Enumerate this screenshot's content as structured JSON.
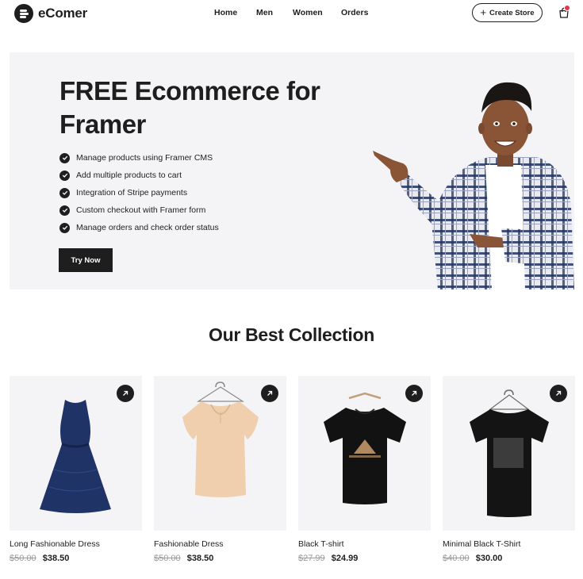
{
  "header": {
    "logo_text": "eComer",
    "nav": [
      "Home",
      "Men",
      "Women",
      "Orders"
    ],
    "create_store_label": "Create Store",
    "cart_badge_color": "#e8334a"
  },
  "hero": {
    "title": "FREE Ecommerce for Framer",
    "features": [
      "Manage products using Framer CMS",
      "Add multiple products to cart",
      "Integration of Stripe payments",
      "Custom checkout with Framer form",
      "Manage orders and check order status"
    ],
    "cta_label": "Try Now"
  },
  "collection": {
    "title": "Our Best Collection",
    "products": [
      {
        "name": "Long Fashionable Dress",
        "old_price": "$50.00",
        "price": "$38.50"
      },
      {
        "name": "Fashionable Dress",
        "old_price": "$50.00",
        "price": "$38.50"
      },
      {
        "name": "Black T-shirt",
        "old_price": "$27.99",
        "price": "$24.99"
      },
      {
        "name": "Minimal Black T-Shirt",
        "old_price": "$40.00",
        "price": "$30.00"
      }
    ]
  },
  "icons": {
    "logo": "logo-mark-icon",
    "plus": "plus-icon",
    "cart": "shopping-bag-icon",
    "check": "check-circle-icon",
    "arrow": "arrow-up-right-icon"
  },
  "colors": {
    "text": "#1e1e1e",
    "hero_bg": "#f4f4f6",
    "card_bg": "#f4f4f6",
    "old_price": "#9a9a9a"
  }
}
